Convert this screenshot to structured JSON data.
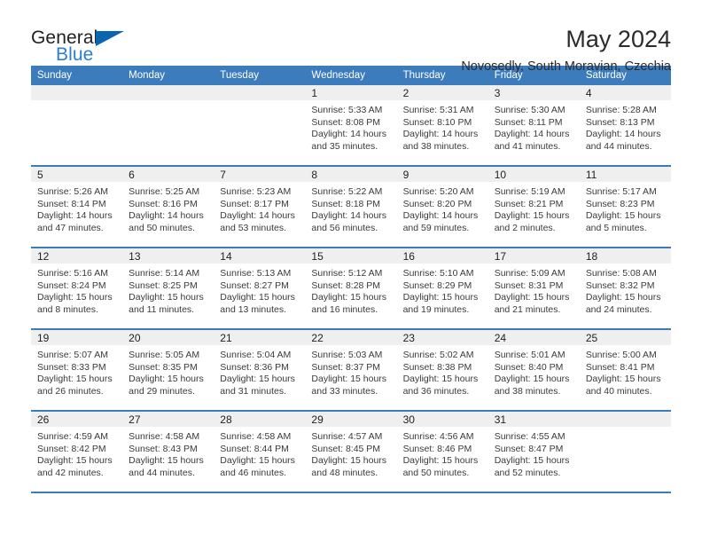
{
  "brand": {
    "name_part1": "General",
    "name_part2": "Blue",
    "triangle_icon": "triangle-icon",
    "accent_color": "#2a7fd4",
    "triangle_color": "#0a65b0"
  },
  "header": {
    "title": "May 2024",
    "subtitle": "Novosedly, South Moravian, Czechia",
    "header_bg": "#3c7cbd",
    "daynum_bg": "#efefef"
  },
  "weekdays": [
    "Sunday",
    "Monday",
    "Tuesday",
    "Wednesday",
    "Thursday",
    "Friday",
    "Saturday"
  ],
  "weeks": [
    [
      {
        "day": "",
        "sunrise": "",
        "sunset": "",
        "daylight1": "",
        "daylight2": ""
      },
      {
        "day": "",
        "sunrise": "",
        "sunset": "",
        "daylight1": "",
        "daylight2": ""
      },
      {
        "day": "",
        "sunrise": "",
        "sunset": "",
        "daylight1": "",
        "daylight2": ""
      },
      {
        "day": "1",
        "sunrise": "Sunrise: 5:33 AM",
        "sunset": "Sunset: 8:08 PM",
        "daylight1": "Daylight: 14 hours",
        "daylight2": "and 35 minutes."
      },
      {
        "day": "2",
        "sunrise": "Sunrise: 5:31 AM",
        "sunset": "Sunset: 8:10 PM",
        "daylight1": "Daylight: 14 hours",
        "daylight2": "and 38 minutes."
      },
      {
        "day": "3",
        "sunrise": "Sunrise: 5:30 AM",
        "sunset": "Sunset: 8:11 PM",
        "daylight1": "Daylight: 14 hours",
        "daylight2": "and 41 minutes."
      },
      {
        "day": "4",
        "sunrise": "Sunrise: 5:28 AM",
        "sunset": "Sunset: 8:13 PM",
        "daylight1": "Daylight: 14 hours",
        "daylight2": "and 44 minutes."
      }
    ],
    [
      {
        "day": "5",
        "sunrise": "Sunrise: 5:26 AM",
        "sunset": "Sunset: 8:14 PM",
        "daylight1": "Daylight: 14 hours",
        "daylight2": "and 47 minutes."
      },
      {
        "day": "6",
        "sunrise": "Sunrise: 5:25 AM",
        "sunset": "Sunset: 8:16 PM",
        "daylight1": "Daylight: 14 hours",
        "daylight2": "and 50 minutes."
      },
      {
        "day": "7",
        "sunrise": "Sunrise: 5:23 AM",
        "sunset": "Sunset: 8:17 PM",
        "daylight1": "Daylight: 14 hours",
        "daylight2": "and 53 minutes."
      },
      {
        "day": "8",
        "sunrise": "Sunrise: 5:22 AM",
        "sunset": "Sunset: 8:18 PM",
        "daylight1": "Daylight: 14 hours",
        "daylight2": "and 56 minutes."
      },
      {
        "day": "9",
        "sunrise": "Sunrise: 5:20 AM",
        "sunset": "Sunset: 8:20 PM",
        "daylight1": "Daylight: 14 hours",
        "daylight2": "and 59 minutes."
      },
      {
        "day": "10",
        "sunrise": "Sunrise: 5:19 AM",
        "sunset": "Sunset: 8:21 PM",
        "daylight1": "Daylight: 15 hours",
        "daylight2": "and 2 minutes."
      },
      {
        "day": "11",
        "sunrise": "Sunrise: 5:17 AM",
        "sunset": "Sunset: 8:23 PM",
        "daylight1": "Daylight: 15 hours",
        "daylight2": "and 5 minutes."
      }
    ],
    [
      {
        "day": "12",
        "sunrise": "Sunrise: 5:16 AM",
        "sunset": "Sunset: 8:24 PM",
        "daylight1": "Daylight: 15 hours",
        "daylight2": "and 8 minutes."
      },
      {
        "day": "13",
        "sunrise": "Sunrise: 5:14 AM",
        "sunset": "Sunset: 8:25 PM",
        "daylight1": "Daylight: 15 hours",
        "daylight2": "and 11 minutes."
      },
      {
        "day": "14",
        "sunrise": "Sunrise: 5:13 AM",
        "sunset": "Sunset: 8:27 PM",
        "daylight1": "Daylight: 15 hours",
        "daylight2": "and 13 minutes."
      },
      {
        "day": "15",
        "sunrise": "Sunrise: 5:12 AM",
        "sunset": "Sunset: 8:28 PM",
        "daylight1": "Daylight: 15 hours",
        "daylight2": "and 16 minutes."
      },
      {
        "day": "16",
        "sunrise": "Sunrise: 5:10 AM",
        "sunset": "Sunset: 8:29 PM",
        "daylight1": "Daylight: 15 hours",
        "daylight2": "and 19 minutes."
      },
      {
        "day": "17",
        "sunrise": "Sunrise: 5:09 AM",
        "sunset": "Sunset: 8:31 PM",
        "daylight1": "Daylight: 15 hours",
        "daylight2": "and 21 minutes."
      },
      {
        "day": "18",
        "sunrise": "Sunrise: 5:08 AM",
        "sunset": "Sunset: 8:32 PM",
        "daylight1": "Daylight: 15 hours",
        "daylight2": "and 24 minutes."
      }
    ],
    [
      {
        "day": "19",
        "sunrise": "Sunrise: 5:07 AM",
        "sunset": "Sunset: 8:33 PM",
        "daylight1": "Daylight: 15 hours",
        "daylight2": "and 26 minutes."
      },
      {
        "day": "20",
        "sunrise": "Sunrise: 5:05 AM",
        "sunset": "Sunset: 8:35 PM",
        "daylight1": "Daylight: 15 hours",
        "daylight2": "and 29 minutes."
      },
      {
        "day": "21",
        "sunrise": "Sunrise: 5:04 AM",
        "sunset": "Sunset: 8:36 PM",
        "daylight1": "Daylight: 15 hours",
        "daylight2": "and 31 minutes."
      },
      {
        "day": "22",
        "sunrise": "Sunrise: 5:03 AM",
        "sunset": "Sunset: 8:37 PM",
        "daylight1": "Daylight: 15 hours",
        "daylight2": "and 33 minutes."
      },
      {
        "day": "23",
        "sunrise": "Sunrise: 5:02 AM",
        "sunset": "Sunset: 8:38 PM",
        "daylight1": "Daylight: 15 hours",
        "daylight2": "and 36 minutes."
      },
      {
        "day": "24",
        "sunrise": "Sunrise: 5:01 AM",
        "sunset": "Sunset: 8:40 PM",
        "daylight1": "Daylight: 15 hours",
        "daylight2": "and 38 minutes."
      },
      {
        "day": "25",
        "sunrise": "Sunrise: 5:00 AM",
        "sunset": "Sunset: 8:41 PM",
        "daylight1": "Daylight: 15 hours",
        "daylight2": "and 40 minutes."
      }
    ],
    [
      {
        "day": "26",
        "sunrise": "Sunrise: 4:59 AM",
        "sunset": "Sunset: 8:42 PM",
        "daylight1": "Daylight: 15 hours",
        "daylight2": "and 42 minutes."
      },
      {
        "day": "27",
        "sunrise": "Sunrise: 4:58 AM",
        "sunset": "Sunset: 8:43 PM",
        "daylight1": "Daylight: 15 hours",
        "daylight2": "and 44 minutes."
      },
      {
        "day": "28",
        "sunrise": "Sunrise: 4:58 AM",
        "sunset": "Sunset: 8:44 PM",
        "daylight1": "Daylight: 15 hours",
        "daylight2": "and 46 minutes."
      },
      {
        "day": "29",
        "sunrise": "Sunrise: 4:57 AM",
        "sunset": "Sunset: 8:45 PM",
        "daylight1": "Daylight: 15 hours",
        "daylight2": "and 48 minutes."
      },
      {
        "day": "30",
        "sunrise": "Sunrise: 4:56 AM",
        "sunset": "Sunset: 8:46 PM",
        "daylight1": "Daylight: 15 hours",
        "daylight2": "and 50 minutes."
      },
      {
        "day": "31",
        "sunrise": "Sunrise: 4:55 AM",
        "sunset": "Sunset: 8:47 PM",
        "daylight1": "Daylight: 15 hours",
        "daylight2": "and 52 minutes."
      },
      {
        "day": "",
        "sunrise": "",
        "sunset": "",
        "daylight1": "",
        "daylight2": ""
      }
    ]
  ]
}
